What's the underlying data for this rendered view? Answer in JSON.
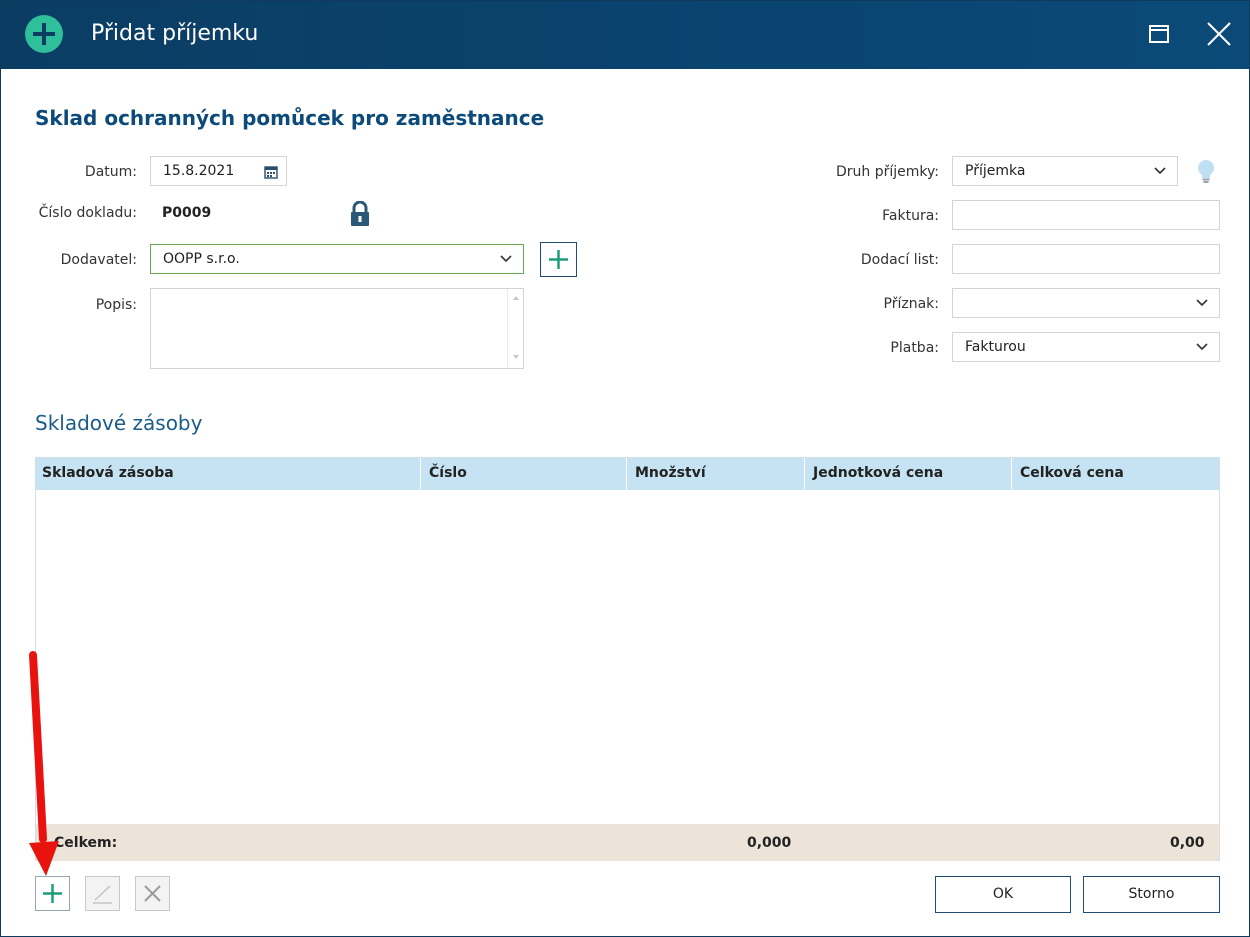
{
  "window": {
    "title": "Přidat příjemku"
  },
  "form": {
    "heading": "Sklad ochranných pomůcek pro zaměstnance",
    "datum_label": "Datum:",
    "datum_value": "15.8.2021",
    "cislo_label": "Číslo dokladu:",
    "cislo_value": "P0009",
    "dodavatel_label": "Dodavatel:",
    "dodavatel_value": "OOPP s.r.o.",
    "popis_label": "Popis:",
    "popis_value": "",
    "druh_label": "Druh příjemky:",
    "druh_value": "Příjemka",
    "faktura_label": "Faktura:",
    "faktura_value": "",
    "dodaci_label": "Dodací list:",
    "dodaci_value": "",
    "priznak_label": "Příznak:",
    "priznak_value": "",
    "platba_label": "Platba:",
    "platba_value": "Fakturou"
  },
  "grid": {
    "section_title": "Skladové zásoby",
    "columns": [
      "Skladová zásoba",
      "Číslo",
      "Množství",
      "Jednotková cena",
      "Celková cena"
    ],
    "rows": [],
    "footer": {
      "label": "Celkem:",
      "mnozstvi_total": "0,000",
      "celkova_total": "0,00"
    }
  },
  "actions": {
    "ok_label": "OK",
    "storno_label": "Storno"
  },
  "icons": {
    "title": "add-circle-icon",
    "datum": "calendar-icon",
    "cislo": "lock-icon",
    "druh_hint": "lightbulb-icon",
    "add": "plus-icon",
    "edit": "pencil-icon",
    "delete": "x-icon"
  },
  "colors": {
    "titlebar": "#0b3d63",
    "accent_green": "#2fbf9a",
    "heading_blue": "#0c4a7a",
    "grid_header": "#c6e3f3",
    "grid_footer": "#ece4d8",
    "annotation_arrow": "#e8130f"
  }
}
